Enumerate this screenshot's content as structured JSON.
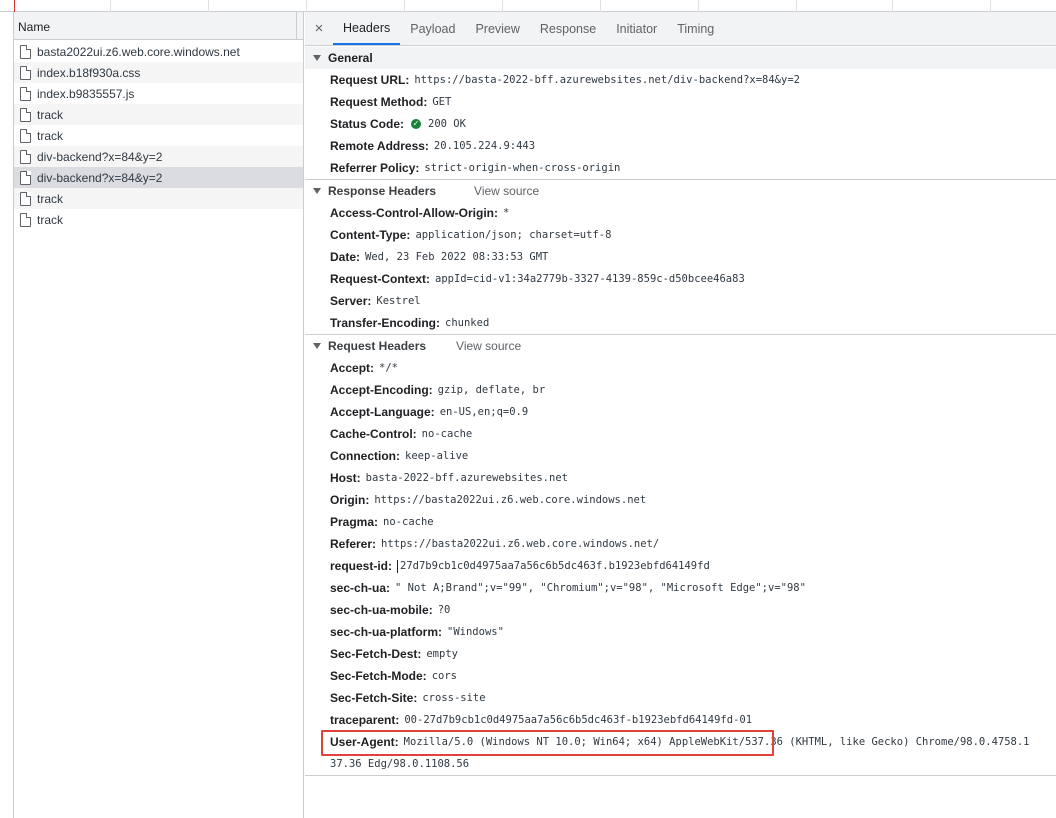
{
  "requests_panel": {
    "column_header": "Name",
    "rows": [
      {
        "name": "basta2022ui.z6.web.core.windows.net"
      },
      {
        "name": "index.b18f930a.css"
      },
      {
        "name": "index.b9835557.js"
      },
      {
        "name": "track"
      },
      {
        "name": "track"
      },
      {
        "name": "div-backend?x=84&y=2"
      },
      {
        "name": "div-backend?x=84&y=2",
        "selected": true
      },
      {
        "name": "track"
      },
      {
        "name": "track"
      }
    ]
  },
  "tabs": {
    "close_symbol": "×",
    "items": [
      "Headers",
      "Payload",
      "Preview",
      "Response",
      "Initiator",
      "Timing"
    ],
    "active": "Headers"
  },
  "general": {
    "title": "General",
    "request_url_label": "Request URL:",
    "request_url": "https://basta-2022-bff.azurewebsites.net/div-backend?x=84&y=2",
    "request_method_label": "Request Method:",
    "request_method": "GET",
    "status_code_label": "Status Code:",
    "status_code": "200 OK",
    "status_icon": "check-circle-icon",
    "remote_address_label": "Remote Address:",
    "remote_address": "20.105.224.9:443",
    "referrer_policy_label": "Referrer Policy:",
    "referrer_policy": "strict-origin-when-cross-origin"
  },
  "response_headers": {
    "title": "Response Headers",
    "view_source": "View source",
    "items": [
      {
        "k": "Access-Control-Allow-Origin:",
        "v": "*"
      },
      {
        "k": "Content-Type:",
        "v": "application/json; charset=utf-8"
      },
      {
        "k": "Date:",
        "v": "Wed, 23 Feb 2022 08:33:53 GMT"
      },
      {
        "k": "Request-Context:",
        "v": "appId=cid-v1:34a2779b-3327-4139-859c-d50bcee46a83"
      },
      {
        "k": "Server:",
        "v": "Kestrel"
      },
      {
        "k": "Transfer-Encoding:",
        "v": "chunked"
      }
    ]
  },
  "request_headers": {
    "title": "Request Headers",
    "view_source": "View source",
    "items": [
      {
        "k": "Accept:",
        "v": "*/*"
      },
      {
        "k": "Accept-Encoding:",
        "v": "gzip, deflate, br"
      },
      {
        "k": "Accept-Language:",
        "v": "en-US,en;q=0.9"
      },
      {
        "k": "Cache-Control:",
        "v": "no-cache"
      },
      {
        "k": "Connection:",
        "v": "keep-alive"
      },
      {
        "k": "Host:",
        "v": "basta-2022-bff.azurewebsites.net"
      },
      {
        "k": "Origin:",
        "v": "https://basta2022ui.z6.web.core.windows.net"
      },
      {
        "k": "Pragma:",
        "v": "no-cache"
      },
      {
        "k": "Referer:",
        "v": "https://basta2022ui.z6.web.core.windows.net/"
      },
      {
        "k": "request-id:",
        "v": "27d7b9cb1c0d4975aa7a56c6b5dc463f.b1923ebfd64149fd"
      },
      {
        "k": "sec-ch-ua:",
        "v": "\" Not A;Brand\";v=\"99\", \"Chromium\";v=\"98\", \"Microsoft Edge\";v=\"98\""
      },
      {
        "k": "sec-ch-ua-mobile:",
        "v": "?0"
      },
      {
        "k": "sec-ch-ua-platform:",
        "v": "\"Windows\""
      },
      {
        "k": "Sec-Fetch-Dest:",
        "v": "empty"
      },
      {
        "k": "Sec-Fetch-Mode:",
        "v": "cors"
      },
      {
        "k": "Sec-Fetch-Site:",
        "v": "cross-site"
      },
      {
        "k": "traceparent:",
        "v": "00-27d7b9cb1c0d4975aa7a56c6b5dc463f-b1923ebfd64149fd-01"
      },
      {
        "k": "User-Agent:",
        "v": "Mozilla/5.0 (Windows NT 10.0; Win64; x64) AppleWebKit/537.36 (KHTML, like Gecko) Chrome/98.0.4758.1"
      }
    ],
    "user_agent_continuation": "37.36 Edg/98.0.1108.56"
  },
  "colors": {
    "highlight_border": "#e0413a",
    "active_tab": "#1a73e8",
    "status_ok": "#188038"
  }
}
